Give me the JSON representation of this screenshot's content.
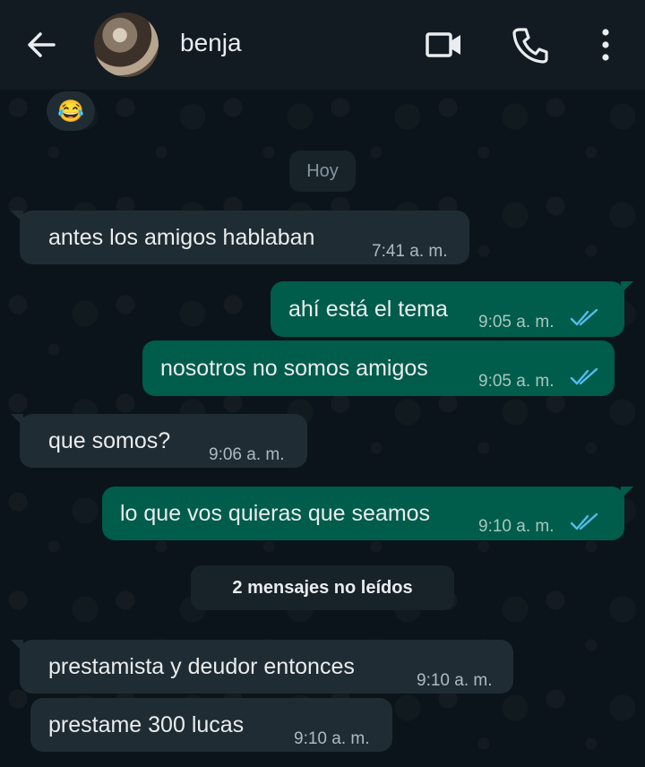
{
  "header": {
    "contact_name": "benja",
    "icons": [
      "back-arrow-icon",
      "video-call-icon",
      "phone-call-icon",
      "more-vertical-icon"
    ]
  },
  "reaction": {
    "emoji": "😂"
  },
  "chat": {
    "date_chip": "Hoy",
    "unread_chip": "2 mensajes no leídos",
    "messages": [
      {
        "direction": "in",
        "text": "antes los amigos hablaban",
        "time": "7:41 a. m."
      },
      {
        "direction": "out",
        "text": "ahí está el tema",
        "time": "9:05 a. m.",
        "status": "read"
      },
      {
        "direction": "out",
        "text": "nosotros no somos amigos",
        "time": "9:05 a. m.",
        "status": "read"
      },
      {
        "direction": "in",
        "text": "que somos?",
        "time": "9:06 a. m."
      },
      {
        "direction": "out",
        "text": "lo que vos quieras que seamos",
        "time": "9:10 a. m.",
        "status": "read"
      },
      {
        "direction": "in",
        "text": "prestamista y deudor entonces",
        "time": "9:10 a. m."
      },
      {
        "direction": "in",
        "text": "prestame 300 lucas",
        "time": "9:10 a. m."
      }
    ]
  },
  "colors": {
    "background": "#0b141a",
    "header": "#111b21",
    "incoming_bubble": "#202c33",
    "outgoing_bubble": "#005c4b",
    "read_ticks": "#53bdeb"
  }
}
